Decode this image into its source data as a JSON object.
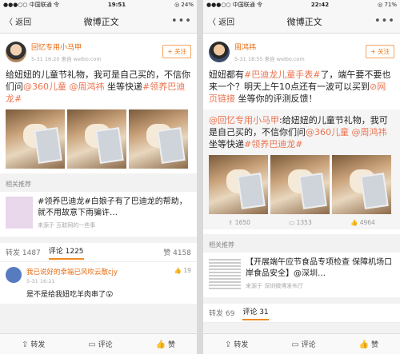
{
  "left": {
    "status": {
      "carrier": "●●●○○ 中国联通 令",
      "time": "19:51",
      "battery": "◎ 24%"
    },
    "nav": {
      "back": "〈 返回",
      "title": "微博正文",
      "more": "•••"
    },
    "post": {
      "user": "回忆专用小马甲",
      "meta": "5-31 16:20 来自 weibo.com",
      "follow": "+ 关注",
      "text_a": "给妞妞的儿童节礼物，我可是自己买的，不信你们问",
      "text_m1": "@360儿童",
      "text_m2": "@周鸿祎",
      "text_b": " 坐等快递",
      "text_tag": "#领养巴迪龙#"
    },
    "related": {
      "heading": "相关推荐",
      "text": "#领养巴迪龙#白娘子有了巴迪龙的帮助，就不用故意下雨骗许…",
      "source": "来源于 互联网的一些事"
    },
    "tabs": {
      "repost": "转发 1487",
      "comment": "评论 1225",
      "like": "赞 4158"
    },
    "comment": {
      "name": "我已说好的幸福已风吹云散cjy",
      "time": "5-31 16:21",
      "likes": "19",
      "text": "是不是给我妞吃羊肉串了😮"
    },
    "bottom": {
      "repost": "转发",
      "comment": "评论",
      "like": "赞"
    }
  },
  "right": {
    "status": {
      "carrier": "●●●○○ 中国联通 令",
      "time": "22:42",
      "battery": "◎ 71%"
    },
    "nav": {
      "back": "〈 返回",
      "title": "微博正文",
      "more": "•••"
    },
    "post": {
      "user": "周鸿祎",
      "meta": "5-31 18:55 来自 weibo.com",
      "follow": "+ 关注",
      "text_a": "妞妞都有",
      "text_tag1": "#巴迪龙儿童手表#",
      "text_b": "了，端午要不要也来一个？明天上午10点还有一波可以买到",
      "text_link": "网页链接",
      "text_c": " 坐等你的评测反馈！"
    },
    "repost": {
      "m0": "@回忆专用小马甲",
      "a": ":给妞妞的儿童节礼物，我可是自己买的，不信你们问",
      "m1": "@360儿童",
      "m2": "@周鸿祎",
      "b": " 坐等快递",
      "tag": "#领养巴迪龙#",
      "c1": "1650",
      "c2": "1353",
      "c3": "4964"
    },
    "related": {
      "heading": "相关推荐",
      "text": "【开展端午应节食品专项检查 保障机场口岸食品安全】@深圳…",
      "source": "来源于 深圳微博发布厅"
    },
    "tabs": {
      "repost": "转发 69",
      "comment": "评论 31"
    },
    "bottom": {
      "repost": "转发",
      "comment": "评论",
      "like": "赞"
    }
  }
}
